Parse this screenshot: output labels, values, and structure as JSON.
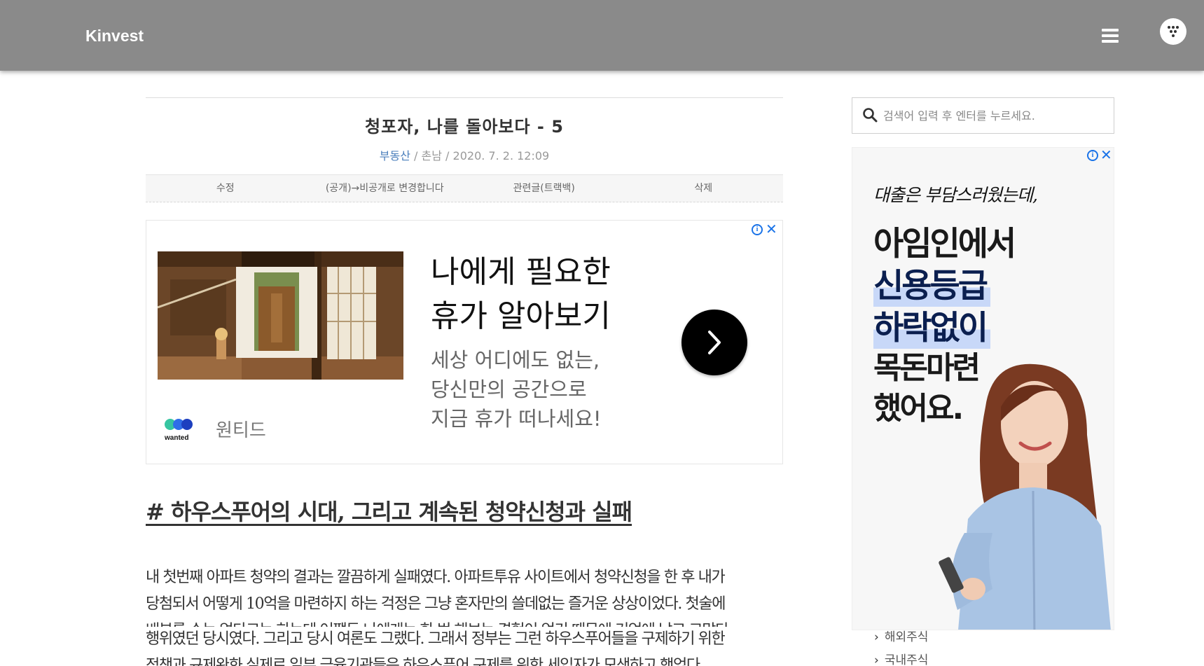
{
  "header": {
    "brand": "Kinvest",
    "menu_icon": "hamburger-menu-icon",
    "avatar_icon": "profile-dots-icon",
    "background": "#8a8a8a"
  },
  "post": {
    "title": "청포자, 나를 돌아보다 - 5",
    "category": "부동산",
    "author": "촌남",
    "date": "2020. 7. 2. 12:09",
    "actions": [
      "수정",
      "(공개)→비공개로 변경합니다",
      "관련글(트랙백)",
      "삭제"
    ]
  },
  "ad1": {
    "headline_1": "나에게 필요한",
    "headline_2": "휴가 알아보기",
    "desc_1": "세상 어디에도 없는,",
    "desc_2": "당신만의 공간으로",
    "desc_3": "지금 휴가 떠나세요!",
    "logo_word": "wanted",
    "advertiser": "원티드",
    "info_glyph": "i",
    "close_glyph": "✕"
  },
  "content": {
    "section_heading": "# 하우스푸어의 시대, 그리고 계속된 청약신청과 실패",
    "line_1": "내 첫번째 아파트 청약의 결과는 깔끔하게 실패였다. 아파트투유 사이트에서 청약신청을 한 후 내가",
    "line_2": "당첨되서 어떻게 10억을 마련하지 하는 걱정은 그냥 혼자만의 쓸데없는 즐거운 상상이었다. 첫술에",
    "line_3": "배부를 수는 없다고는 하는데 어쨌든 나에게는 한 번 해보는 경험이 얻기 때문에 기억에 남고 고맙다",
    "line_4": "행위였던 당시였다. 그리고 당시 여론도 그랬다. 그래서 정부는 그런 하우스푸어들을 구제하기 위한",
    "line_5": "정책과 규제완화 실제로 일부 금융기관들은 하우스푸어 구제를 위한 세입자가 모색하고 했었다"
  },
  "sidebar": {
    "search_placeholder": "검색어 입력 후 엔터를 누르세요.",
    "ad2": {
      "handwritten": "대출은 부담스러웠는데,",
      "line_1": "아임인에서",
      "line_2": "신용등급",
      "line_3": "하락없이",
      "line_4": "목돈마련",
      "line_5": "했어요."
    },
    "links": [
      "해외주식",
      "국내주식"
    ]
  },
  "colors": {
    "accent_link": "#4a7ebb",
    "ad_choices": "#1a73e8",
    "highlight": "#c8d8f8"
  }
}
